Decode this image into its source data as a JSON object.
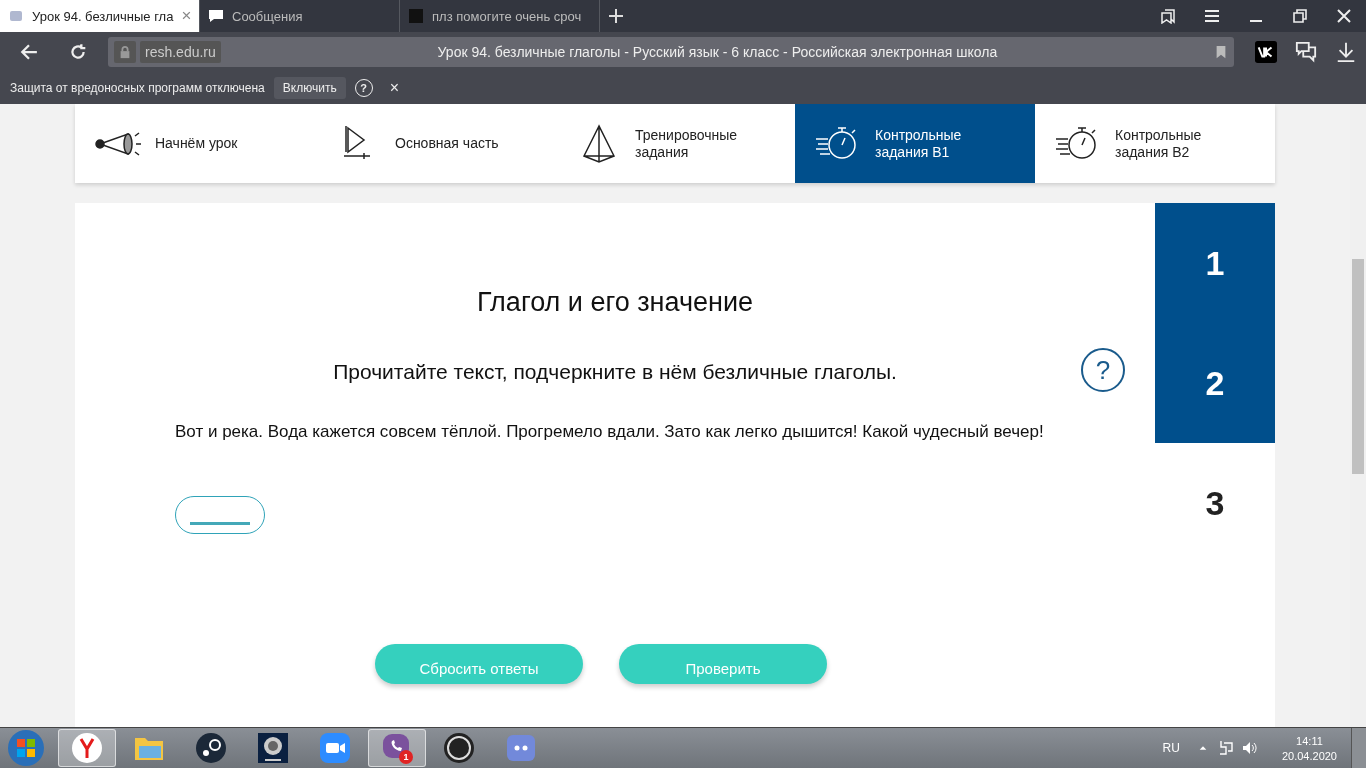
{
  "browser_tabs": [
    {
      "title": "Урок 94. безличные гла",
      "selected": true,
      "close": "×"
    },
    {
      "title": "Сообщения",
      "selected": false
    },
    {
      "title": "плз помогите очень сроч",
      "selected": false
    }
  ],
  "address_bar": {
    "domain": "resh.edu.ru",
    "page_title": "Урок 94. безличные глаголы - Русский язык - 6 класс - Российская электронная школа"
  },
  "notice": {
    "text": "Защита от вредоносных программ отключена",
    "button": "Включить",
    "help": "?",
    "close": "×"
  },
  "lesson_nav": [
    {
      "label": "Начнём урок",
      "kind": "megaphone",
      "selected": false
    },
    {
      "label": "Основная часть",
      "kind": "play",
      "selected": false
    },
    {
      "label": "Тренировочные задания",
      "kind": "pyramid",
      "selected": false
    },
    {
      "label": "Контрольные задания В1",
      "kind": "stopwatch",
      "selected": true
    },
    {
      "label": "Контрольные задания В2",
      "kind": "stopwatch",
      "selected": false
    }
  ],
  "task": {
    "title": "Глагол и его значение",
    "instruction": "Прочитайте текст, подчеркните в нём безличные глаголы.",
    "help": "?",
    "text": "Вот и река. Вода кажется совсем тёплой. Прогремело вдали. Зато как легко дышится! Какой чудесный вечер!"
  },
  "task_numbers": [
    {
      "label": "1",
      "selected": true
    },
    {
      "label": "2",
      "selected": true
    },
    {
      "label": "3",
      "selected": false
    }
  ],
  "buttons": [
    "Сбросить ответы",
    "Проверить"
  ],
  "taskbar": {
    "apps": [
      {
        "kind": "yandex",
        "selected": true
      },
      {
        "kind": "folder",
        "selected": false
      },
      {
        "kind": "steam",
        "selected": false
      },
      {
        "kind": "webcam",
        "selected": false
      },
      {
        "kind": "zoom",
        "selected": false
      },
      {
        "kind": "viber",
        "selected": true,
        "badge": "1"
      },
      {
        "kind": "obs",
        "selected": false
      },
      {
        "kind": "discord",
        "selected": false
      }
    ],
    "language": "RU",
    "time": "14:11",
    "date": "20.04.2020"
  }
}
